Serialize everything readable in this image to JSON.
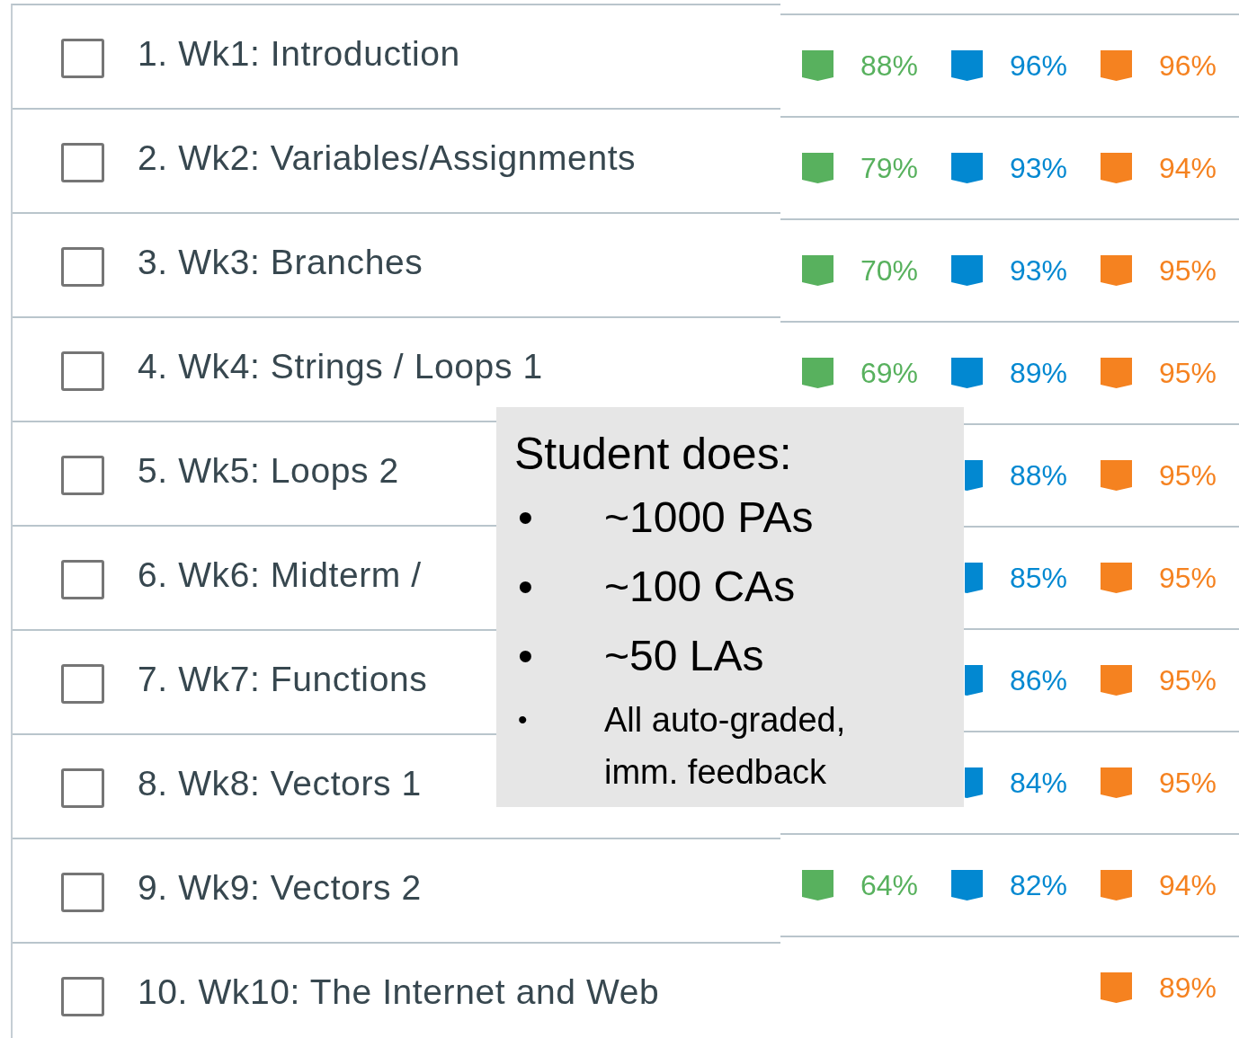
{
  "chapters": [
    {
      "title": "1. Wk1: Introduction",
      "checked": false,
      "stats": [
        {
          "kind": "participation",
          "value": "88%"
        },
        {
          "kind": "challenge",
          "value": "96%"
        },
        {
          "kind": "lab",
          "value": "96%"
        }
      ]
    },
    {
      "title": "2. Wk2: Variables/Assignments",
      "checked": false,
      "stats": [
        {
          "kind": "participation",
          "value": "79%"
        },
        {
          "kind": "challenge",
          "value": "93%"
        },
        {
          "kind": "lab",
          "value": "94%"
        }
      ]
    },
    {
      "title": "3. Wk3: Branches",
      "checked": false,
      "stats": [
        {
          "kind": "participation",
          "value": "70%"
        },
        {
          "kind": "challenge",
          "value": "93%"
        },
        {
          "kind": "lab",
          "value": "95%"
        }
      ]
    },
    {
      "title": "4. Wk4: Strings / Loops 1",
      "checked": false,
      "stats": [
        {
          "kind": "participation",
          "value": "69%"
        },
        {
          "kind": "challenge",
          "value": "89%"
        },
        {
          "kind": "lab",
          "value": "95%"
        }
      ]
    },
    {
      "title": "5. Wk5: Loops 2",
      "checked": false,
      "stats": [
        {
          "kind": "challenge",
          "value": "88%",
          "cut": true
        },
        {
          "kind": "lab",
          "value": "95%"
        }
      ]
    },
    {
      "title": "6. Wk6: Midterm /",
      "checked": false,
      "stats": [
        {
          "kind": "challenge",
          "value": "85%",
          "cut": true
        },
        {
          "kind": "lab",
          "value": "95%"
        }
      ]
    },
    {
      "title": "7. Wk7: Functions",
      "checked": false,
      "stats": [
        {
          "kind": "challenge",
          "value": "86%",
          "cut": true
        },
        {
          "kind": "lab",
          "value": "95%"
        }
      ]
    },
    {
      "title": "8. Wk8: Vectors 1",
      "checked": false,
      "stats": [
        {
          "kind": "challenge",
          "value": "84%",
          "cut": true
        },
        {
          "kind": "lab",
          "value": "95%"
        }
      ]
    },
    {
      "title": "9. Wk9: Vectors 2",
      "checked": false,
      "stats": [
        {
          "kind": "participation",
          "value": "64%"
        },
        {
          "kind": "challenge",
          "value": "82%"
        },
        {
          "kind": "lab",
          "value": "94%"
        }
      ]
    },
    {
      "title": "10. Wk10: The Internet and Web",
      "checked": false,
      "stats": [
        {
          "kind": "lab",
          "value": "89%"
        }
      ]
    }
  ],
  "callout": {
    "title": "Student does:",
    "items": [
      {
        "kind": "large",
        "bullet": "•",
        "text": "~1000 PAs"
      },
      {
        "kind": "large",
        "bullet": "•",
        "text": "~100 CAs"
      },
      {
        "kind": "large",
        "bullet": "•",
        "text": "~50 LAs"
      },
      {
        "kind": "small",
        "bullet": "•",
        "text": "All auto-graded, imm. feedback"
      }
    ]
  }
}
